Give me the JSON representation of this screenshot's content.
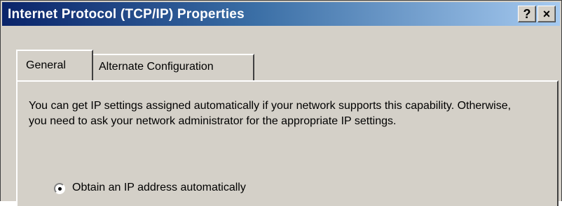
{
  "window": {
    "title": "Internet Protocol (TCP/IP) Properties",
    "help_label": "?",
    "close_label": "×"
  },
  "tabs": [
    {
      "label": "General",
      "selected": true
    },
    {
      "label": "Alternate Configuration",
      "selected": false
    }
  ],
  "general": {
    "description": "You can get IP settings assigned automatically if your network supports this capability. Otherwise, you need to ask your network administrator for the appropriate IP settings.",
    "options": [
      {
        "label": "Obtain an IP address automatically",
        "selected": true
      }
    ]
  },
  "colors": {
    "titlebar_start": "#0a246a",
    "titlebar_end": "#a6caf0",
    "face": "#d4d0c8"
  }
}
